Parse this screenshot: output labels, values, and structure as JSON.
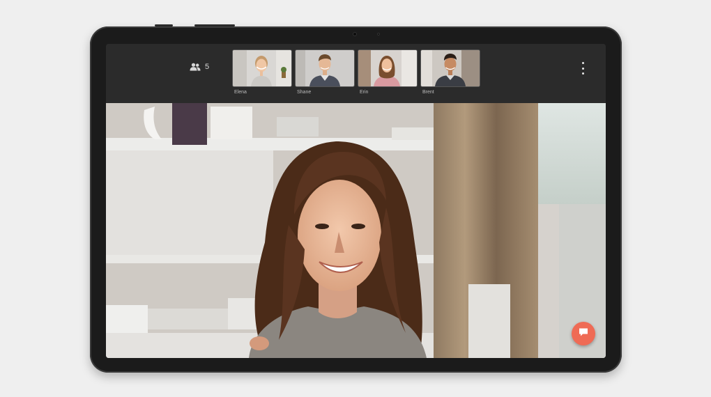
{
  "participants": {
    "icon": "people-icon",
    "count": "5"
  },
  "thumbnails": [
    {
      "name": "Elena"
    },
    {
      "name": "Shane"
    },
    {
      "name": "Erin"
    },
    {
      "name": "Brent"
    }
  ],
  "menu": {
    "icon": "more-vertical-icon"
  },
  "chat": {
    "icon": "chat-bubble-icon",
    "color": "#ef6b55"
  },
  "colors": {
    "device": "#1b1b1b",
    "toolbar": "#2b2b2b",
    "background": "#efefef"
  }
}
